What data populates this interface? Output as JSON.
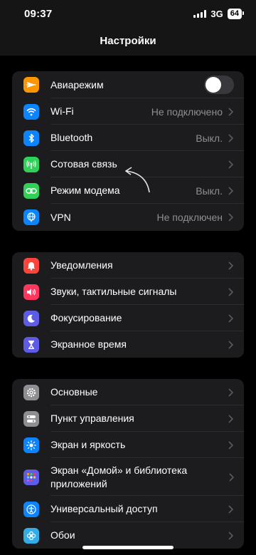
{
  "status_bar": {
    "time": "09:37",
    "network": "3G",
    "battery": "64"
  },
  "header": {
    "title": "Настройки"
  },
  "groups": [
    {
      "rows": [
        {
          "label": "Авиарежим",
          "value": "",
          "icon": "airplane-icon",
          "color": "#ff9500",
          "control": "toggle",
          "toggle_on": false
        },
        {
          "label": "Wi-Fi",
          "value": "Не подключено",
          "icon": "wifi-icon",
          "color": "#0a84ff"
        },
        {
          "label": "Bluetooth",
          "value": "Выкл.",
          "icon": "bluetooth-icon",
          "color": "#0a84ff"
        },
        {
          "label": "Сотовая связь",
          "value": "",
          "icon": "cellular-icon",
          "color": "#30d158"
        },
        {
          "label": "Режим модема",
          "value": "Выкл.",
          "icon": "hotspot-icon",
          "color": "#30d158"
        },
        {
          "label": "VPN",
          "value": "Не подключен",
          "icon": "globe-icon",
          "color": "#0a84ff"
        }
      ]
    },
    {
      "rows": [
        {
          "label": "Уведомления",
          "value": "",
          "icon": "bell-icon",
          "color": "#ff453a"
        },
        {
          "label": "Звуки, тактильные сигналы",
          "value": "",
          "icon": "speaker-icon",
          "color": "#ff375f"
        },
        {
          "label": "Фокусирование",
          "value": "",
          "icon": "moon-icon",
          "color": "#5e5ce6"
        },
        {
          "label": "Экранное время",
          "value": "",
          "icon": "hourglass-icon",
          "color": "#5e5ce6"
        }
      ]
    },
    {
      "rows": [
        {
          "label": "Основные",
          "value": "",
          "icon": "gear-icon",
          "color": "#8e8e93"
        },
        {
          "label": "Пункт управления",
          "value": "",
          "icon": "switches-icon",
          "color": "#8e8e93"
        },
        {
          "label": "Экран и яркость",
          "value": "",
          "icon": "sun-icon",
          "color": "#0a84ff"
        },
        {
          "label": "Экран «Домой» и библиотека приложений",
          "value": "",
          "icon": "grid-icon",
          "color": "#5e5ce6"
        },
        {
          "label": "Универсальный доступ",
          "value": "",
          "icon": "accessibility-icon",
          "color": "#0a84ff"
        },
        {
          "label": "Обои",
          "value": "",
          "icon": "flower-icon",
          "color": "#32ade6"
        }
      ]
    }
  ]
}
